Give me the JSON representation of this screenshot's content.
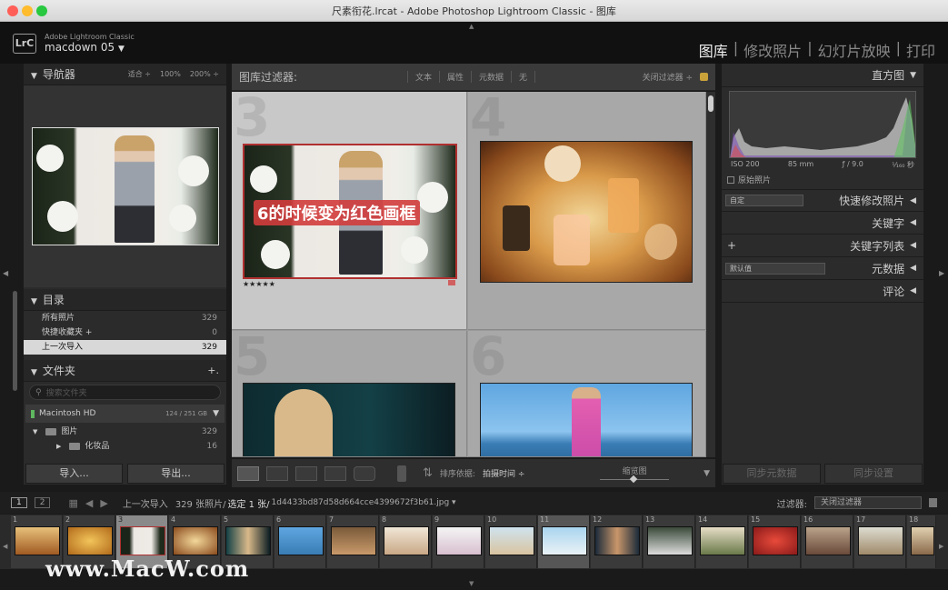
{
  "window": {
    "title": "尺素衔花.lrcat - Adobe Photoshop Lightroom Classic - 图库"
  },
  "identity": {
    "logo": "LrC",
    "app_name": "Adobe Lightroom Classic",
    "catalog": "macdown 05",
    "catalog_arrow": "▼"
  },
  "modules": [
    {
      "label": "图库"
    },
    {
      "label": "|"
    },
    {
      "label": "修改照片"
    },
    {
      "label": "|"
    },
    {
      "label": "幻灯片放映"
    },
    {
      "label": "|"
    },
    {
      "label": "打印"
    }
  ],
  "navigator": {
    "title": "导航器",
    "fit": "适合 ÷",
    "z100": "100%",
    "z200": "200% ÷"
  },
  "catalog": {
    "title": "目录",
    "items": [
      {
        "label": "所有照片",
        "count": "329"
      },
      {
        "label": "快捷收藏夹 +",
        "count": "0"
      },
      {
        "label": "上一次导入",
        "count": "329"
      }
    ]
  },
  "folders": {
    "title": "文件夹",
    "add": "+.",
    "search_placeholder": "搜索文件夹",
    "volume": {
      "name": "Macintosh HD",
      "space": "124 / 251 GB"
    },
    "items": [
      {
        "label": "图片",
        "count": "329"
      },
      {
        "label": "化妆品",
        "count": "16"
      }
    ]
  },
  "left_buttons": {
    "import": "导入...",
    "export": "导出..."
  },
  "filter_bar": {
    "title": "图库过滤器:",
    "text": "文本",
    "attribute": "属性",
    "metadata": "元数据",
    "none": "无",
    "off": "关闭过滤器 ÷"
  },
  "grid": {
    "cells": [
      {
        "num": "3",
        "rating": "★★★★★",
        "overlay": "6的时候变为红色画框"
      },
      {
        "num": "4"
      },
      {
        "num": "5"
      },
      {
        "num": "6"
      }
    ]
  },
  "toolbar": {
    "sort_label": "排序依据:",
    "sort_value": "拍摄时间 ÷",
    "thumb_label": "缩览图"
  },
  "histogram": {
    "title": "直方图",
    "iso": "ISO 200",
    "focal": "85 mm",
    "aperture": "ƒ / 9.0",
    "shutter": "¹⁄₁₆₀ 秒",
    "original": "原始照片"
  },
  "right_panels": {
    "quick_preset": "自定",
    "quick_develop": "快速修改照片",
    "keywording": "关键字",
    "keyword_list": "关键字列表",
    "keyword_plus": "+",
    "metadata_preset": "默认值",
    "metadata": "元数据",
    "comments": "评论",
    "sync_metadata": "同步元数据",
    "sync_settings": "同步设置"
  },
  "filmstrip_bar": {
    "screen1": "1",
    "screen2": "2",
    "source": "上一次导入",
    "count": "329 张照片/",
    "selected": "选定 1 张/",
    "filename": "1d4433bd87d58d664cce4399672f3b61.jpg ▾",
    "filter_label": "过滤器:",
    "filter_value": "关闭过滤器"
  },
  "filmstrip": [
    "1",
    "2",
    "3",
    "4",
    "5",
    "6",
    "7",
    "8",
    "9",
    "10",
    "11",
    "12",
    "13",
    "14",
    "15",
    "16",
    "17",
    "18"
  ],
  "watermark": "www.MacW.com",
  "colors": {
    "accent_red": "#b03030",
    "background": "#1a1a1a",
    "panel": "#2b2b2b",
    "grid": "#a8a8a8"
  }
}
